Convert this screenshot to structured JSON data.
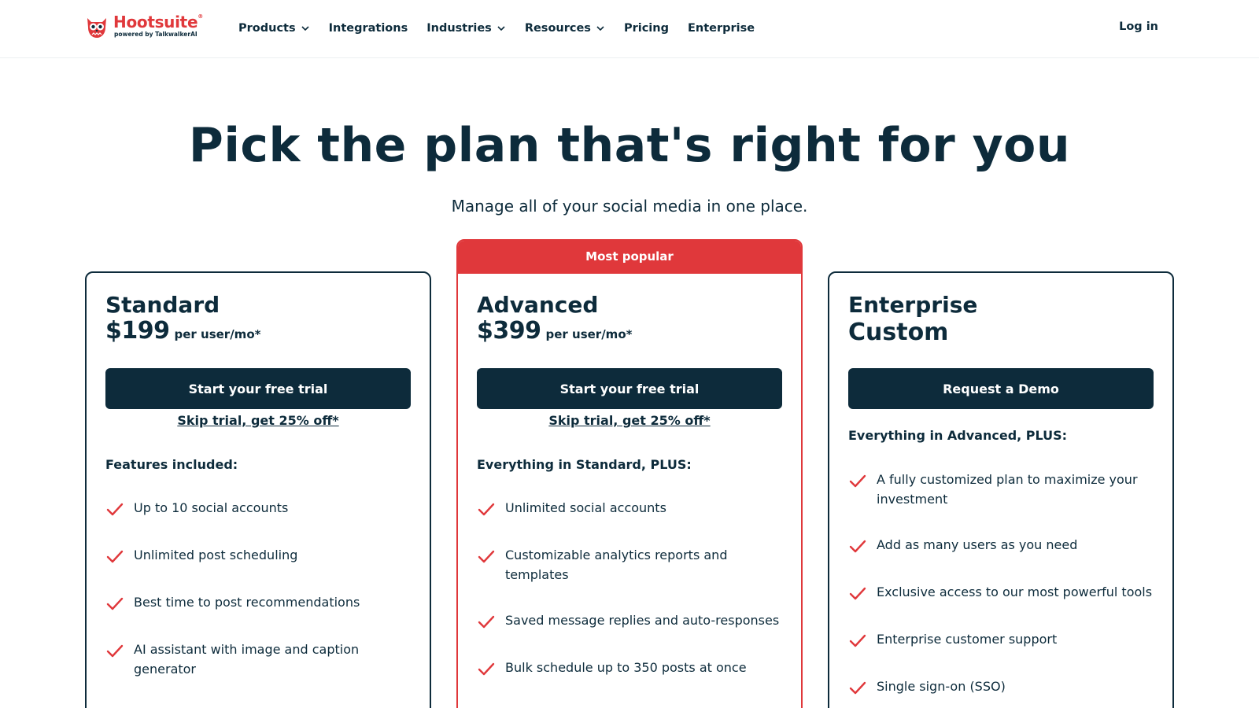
{
  "brand": {
    "name": "Hootsuite",
    "registered": "®",
    "powered_by": "powered by TalkwalkerAI",
    "accent_color": "#e0383b",
    "navy_color": "#0d2b3b"
  },
  "nav": {
    "items": [
      {
        "label": "Products",
        "has_dropdown": true
      },
      {
        "label": "Integrations",
        "has_dropdown": false
      },
      {
        "label": "Industries",
        "has_dropdown": true
      },
      {
        "label": "Resources",
        "has_dropdown": true
      },
      {
        "label": "Pricing",
        "has_dropdown": false
      },
      {
        "label": "Enterprise",
        "has_dropdown": false
      }
    ],
    "login": "Log in"
  },
  "hero": {
    "title": "Pick the plan that's right for you",
    "subtitle": "Manage all of your social media in one place."
  },
  "plans": [
    {
      "name": "Standard",
      "price": "$199",
      "per": "per user/mo*",
      "cta": "Start your free trial",
      "skip": "Skip trial, get 25% off*",
      "features_heading": "Features included:",
      "features": [
        "Up to 10 social accounts",
        "Unlimited post scheduling",
        "Best time to post recommendations",
        "AI assistant with image and caption generator"
      ]
    },
    {
      "badge": "Most popular",
      "name": "Advanced",
      "price": "$399",
      "per": "per user/mo*",
      "cta": "Start your free trial",
      "skip": "Skip trial, get 25% off*",
      "features_heading": "Everything in Standard, PLUS:",
      "features": [
        "Unlimited social accounts",
        "Customizable analytics reports and templates",
        "Saved message replies and auto-responses",
        "Bulk schedule up to 350 posts at once"
      ]
    },
    {
      "name": "Enterprise",
      "price_text": "Custom",
      "cta": "Request a Demo",
      "features_heading": "Everything in Advanced, PLUS:",
      "features": [
        "A fully customized plan to maximize your investment",
        "Add as many users as you need",
        "Exclusive access to our most powerful tools",
        "Enterprise customer support",
        "Single sign-on (SSO)"
      ]
    }
  ]
}
